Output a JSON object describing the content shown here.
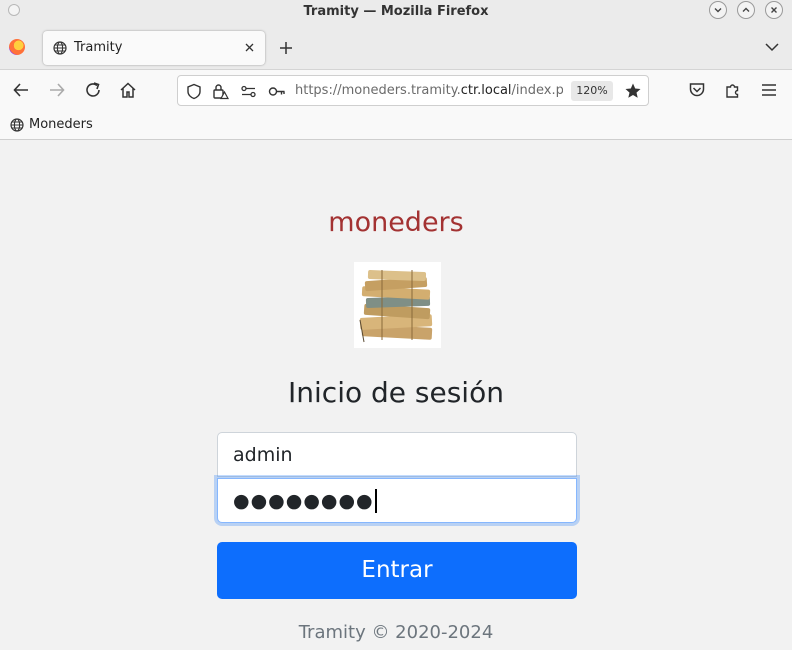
{
  "window": {
    "title": "Tramity — Mozilla Firefox"
  },
  "tabs": [
    {
      "label": "Tramity"
    }
  ],
  "navbar": {
    "url_prefix": "https://moneders.tramity.",
    "url_domain": "ctr.local",
    "url_suffix": "/index.p",
    "zoom": "120%"
  },
  "bookmarks": [
    {
      "label": "Moneders"
    }
  ],
  "page": {
    "brand": "moneders",
    "heading": "Inicio de sesión",
    "username_value": "admin",
    "password_value": "●●●●●●●●",
    "submit_label": "Entrar",
    "footer": "Tramity © 2020-2024"
  },
  "colors": {
    "brand": "#a33232",
    "button": "#0d6efd",
    "footer_text": "#6c757d"
  },
  "icons": {
    "back": "arrow-left-icon",
    "forward": "arrow-right-icon",
    "reload": "reload-icon",
    "home": "home-icon",
    "pocket": "pocket-icon",
    "extensions": "puzzle-icon",
    "menu": "hamburger-menu-icon"
  }
}
